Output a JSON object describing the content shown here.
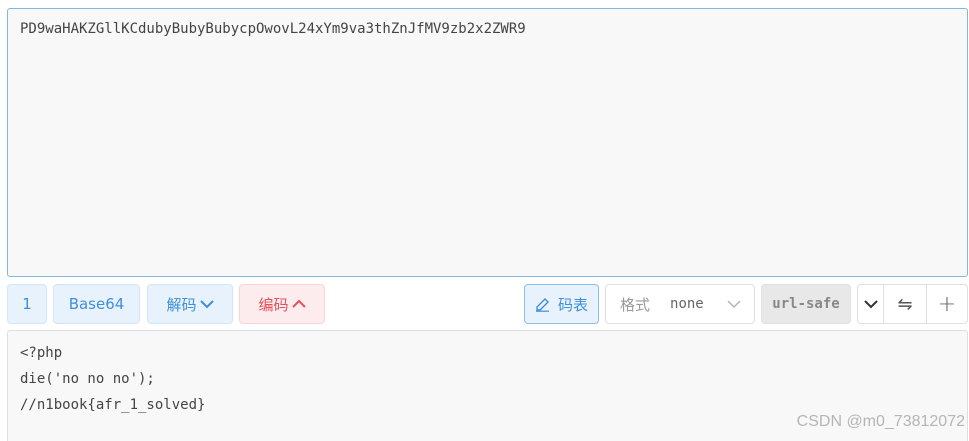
{
  "input": {
    "value": "PD9waHAKZGllKCdubyBubyBubycpOwovL24xYm9va3thZnJfMV9zb2x2ZWR9"
  },
  "toolbar": {
    "count_label": "1",
    "codec_label": "Base64",
    "decode_label": "解码",
    "encode_label": "编码",
    "code_table_label": "码表",
    "format_label": "格式",
    "format_value": "none",
    "url_safe_label": "url-safe",
    "swap_label": "⇋",
    "add_label": "+"
  },
  "output": {
    "value": "<?php\ndie('no no no');\n//n1book{afr_1_solved}"
  },
  "watermark": "CSDN @m0_73812072",
  "colors": {
    "accent_blue": "#3f8fd8",
    "accent_red": "#e0525d"
  }
}
